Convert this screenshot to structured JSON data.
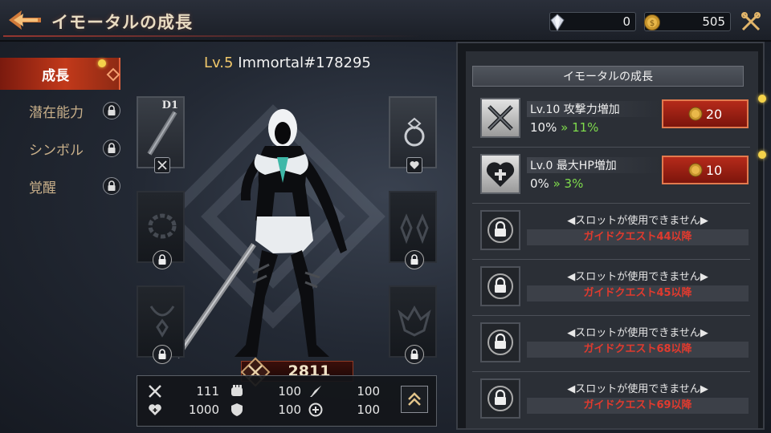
{
  "header": {
    "title": "イモータルの成長",
    "gems": "0",
    "gold": "505"
  },
  "menu": [
    {
      "label": "成長",
      "active": true
    },
    {
      "label": "潜在能力",
      "locked": true
    },
    {
      "label": "シンボル",
      "locked": true
    },
    {
      "label": "覚醒",
      "locked": true
    }
  ],
  "character": {
    "level_label": "Lv.5",
    "name": "Immortal#178295",
    "weapon_slot_label": "D1",
    "combat_power": "2811"
  },
  "stats": {
    "attack": "111",
    "defense_power": "100",
    "penetration": "100",
    "hp": "1000",
    "armor": "100",
    "evasion": "100"
  },
  "growth_panel": {
    "title": "イモータルの成長",
    "upgrades": [
      {
        "level": "Lv.10",
        "name": "攻撃力増加",
        "current": "10%",
        "arrow": "»",
        "next": "11%",
        "cost": "20"
      },
      {
        "level": "Lv.0",
        "name": "最大HP増加",
        "current": "0%",
        "arrow": "»",
        "next": "3%",
        "cost": "10"
      }
    ],
    "locked_slots": [
      {
        "title": "スロットが使用できません",
        "condition": "ガイドクエスト44以降"
      },
      {
        "title": "スロットが使用できません",
        "condition": "ガイドクエスト45以降"
      },
      {
        "title": "スロットが使用できません",
        "condition": "ガイドクエスト68以降"
      },
      {
        "title": "スロットが使用できません",
        "condition": "ガイドクエスト69以降"
      }
    ]
  },
  "colors": {
    "accent_red": "#c2391a",
    "upgrade_green": "#7fdc4c",
    "lock_red": "#e03a2e",
    "notice_yellow": "#f4d24a"
  }
}
